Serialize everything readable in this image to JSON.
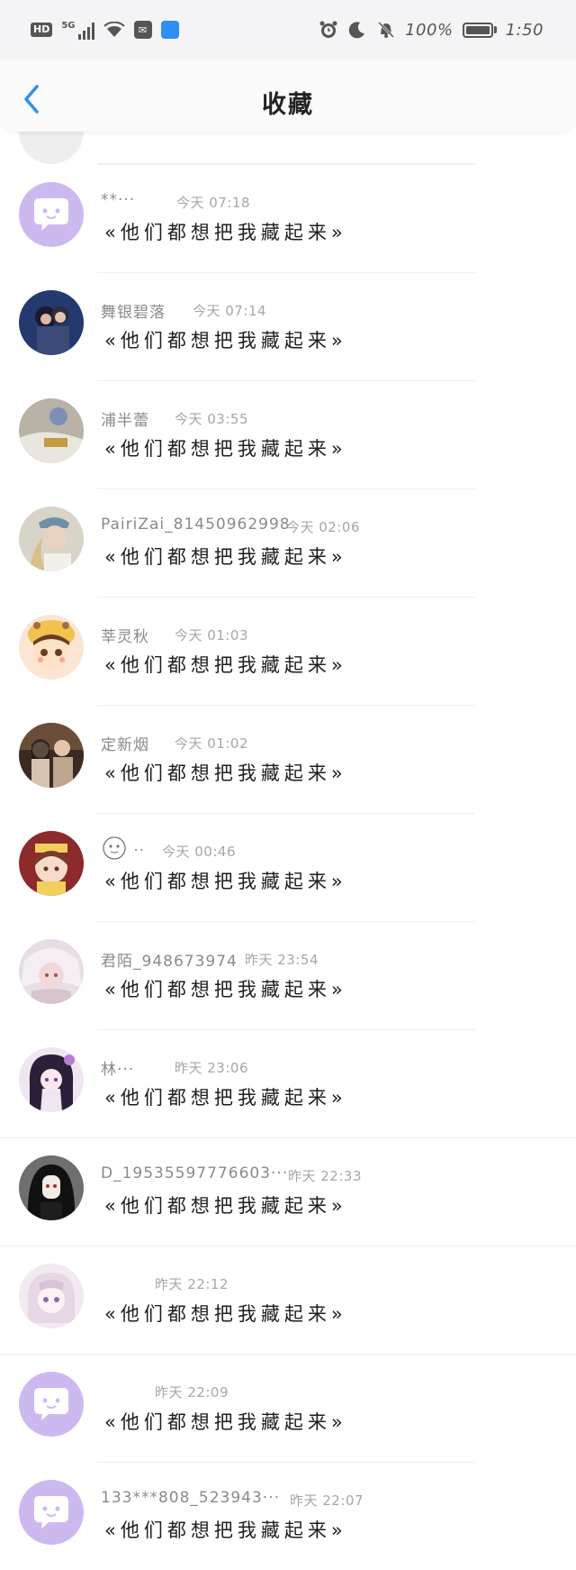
{
  "status_bar": {
    "hd_badge": "HD",
    "network": "5G",
    "battery_percent": "100%",
    "time": "1:50",
    "icons": [
      "alarm-icon",
      "moon-icon",
      "bell-off-icon",
      "battery-icon"
    ]
  },
  "header": {
    "title": "收藏",
    "back_icon": "chevron-left-icon",
    "accent": "#2f8ff0"
  },
  "items": [
    {
      "name": "**···",
      "time": "今天 07:18",
      "message": "«他们都想把我藏起来»",
      "avatar": "default-chat-avatar"
    },
    {
      "name": "舞银碧落",
      "time": "今天 07:14",
      "message": "«他们都想把我藏起来»",
      "avatar": "photo-avatar"
    },
    {
      "name": "浦半蕾",
      "time": "今天 03:55",
      "message": "«他们都想把我藏起来»",
      "avatar": "photo-avatar"
    },
    {
      "name": "PairiZai_81450962998",
      "time": "今天 02:06",
      "message": "«他们都想把我藏起来»",
      "avatar": "photo-avatar"
    },
    {
      "name": "莘灵秋",
      "time": "今天 01:03",
      "message": "«他们都想把我藏起来»",
      "avatar": "cartoon-avatar"
    },
    {
      "name": "定新烟",
      "time": "今天 01:02",
      "message": "«他们都想把我藏起来»",
      "avatar": "photo-avatar"
    },
    {
      "name": "··",
      "time": "今天 00:46",
      "message": "«他们都想把我藏起来»",
      "avatar": "cartoon-avatar"
    },
    {
      "name": "君陌_948673974",
      "time": "昨天 23:54",
      "message": "«他们都想把我藏起来»",
      "avatar": "photo-avatar"
    },
    {
      "name": "林···",
      "time": "昨天 23:06",
      "message": "«他们都想把我藏起来»",
      "avatar": "anime-avatar"
    },
    {
      "name": "D_19535597776603···",
      "time": "昨天 22:33",
      "message": "«他们都想把我藏起来»",
      "avatar": "anime-avatar"
    },
    {
      "name": "",
      "time": "昨天 22:12",
      "message": "«他们都想把我藏起来»",
      "avatar": "anime-avatar"
    },
    {
      "name": "",
      "time": "昨天 22:09",
      "message": "«他们都想把我藏起来»",
      "avatar": "default-chat-avatar"
    },
    {
      "name": "133***808_523943···",
      "time": "昨天 22:07",
      "message": "«他们都想把我藏起来»",
      "avatar": "default-chat-avatar"
    }
  ]
}
